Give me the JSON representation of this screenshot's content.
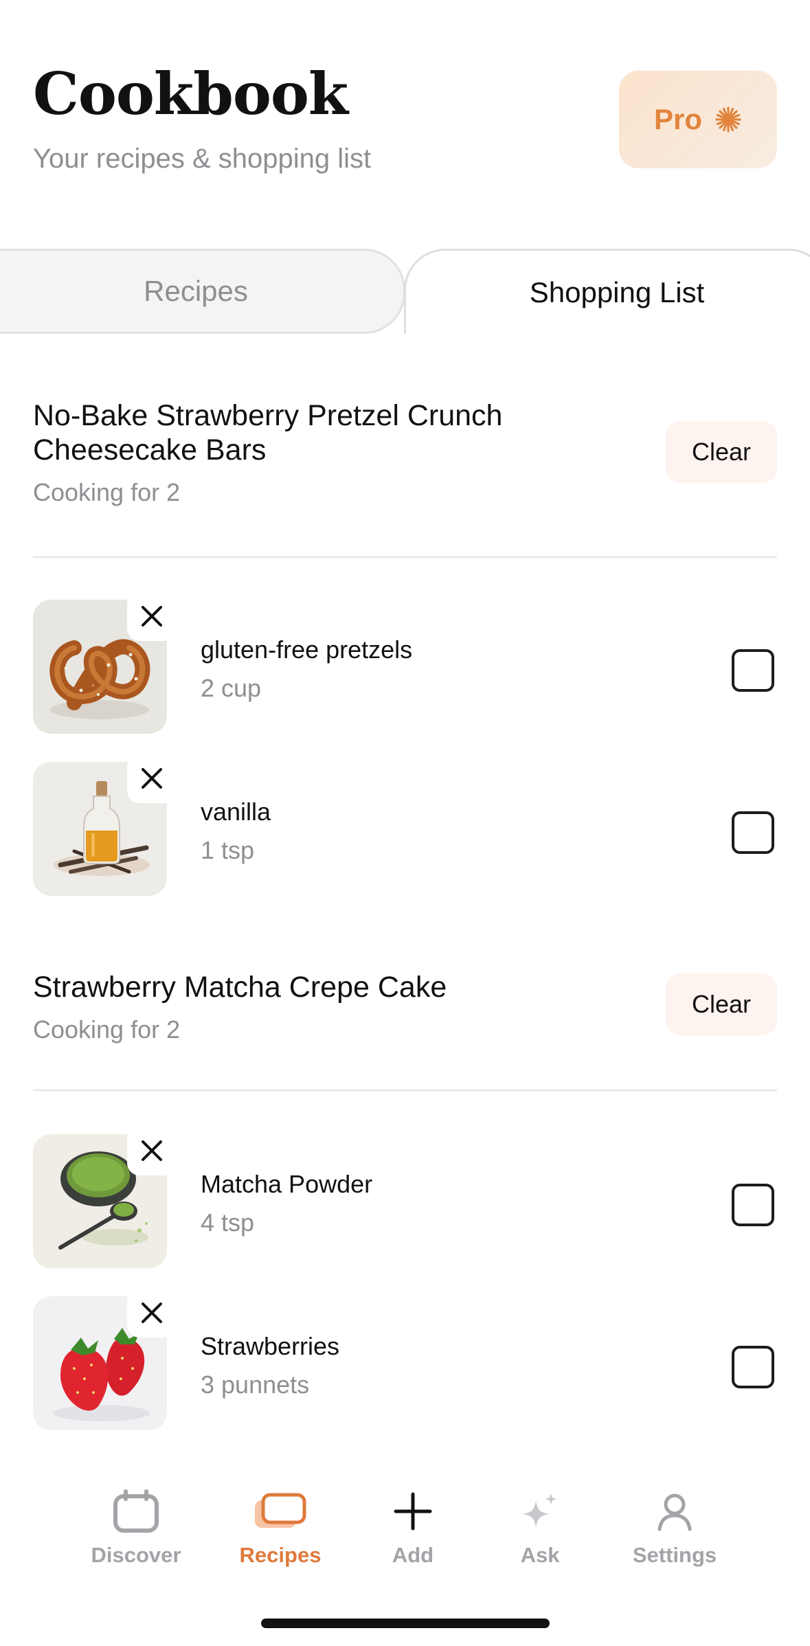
{
  "header": {
    "title": "Cookbook",
    "subtitle": "Your recipes & shopping list",
    "pro_label": "Pro"
  },
  "tabs": [
    {
      "label": "Recipes",
      "active": false
    },
    {
      "label": "Shopping List",
      "active": true
    }
  ],
  "groups": [
    {
      "title": "No-Bake Strawberry Pretzel Crunch Cheesecake Bars",
      "servings": "Cooking for 2",
      "clear_label": "Clear",
      "items": [
        {
          "name": "gluten-free pretzels",
          "quantity": "2 cup",
          "image": "pretzel-image",
          "checked": false
        },
        {
          "name": "vanilla",
          "quantity": "1 tsp",
          "image": "vanilla-bottle-image",
          "checked": false
        }
      ]
    },
    {
      "title": "Strawberry Matcha Crepe Cake",
      "servings": "Cooking for 2",
      "clear_label": "Clear",
      "items": [
        {
          "name": "Matcha Powder",
          "quantity": "4 tsp",
          "image": "matcha-bowl-image",
          "checked": false
        },
        {
          "name": "Strawberries",
          "quantity": "3 punnets",
          "image": "strawberries-image",
          "checked": false
        }
      ]
    }
  ],
  "bottom_nav": [
    {
      "label": "Discover",
      "icon": "calendar-icon",
      "active": false
    },
    {
      "label": "Recipes",
      "icon": "card-stack-icon",
      "active": true
    },
    {
      "label": "Add",
      "icon": "plus-icon",
      "active": false
    },
    {
      "label": "Ask",
      "icon": "sparkle-icon",
      "active": false
    },
    {
      "label": "Settings",
      "icon": "person-icon",
      "active": false
    }
  ],
  "colors": {
    "accent": "#de7a3c",
    "pro_text": "#e2843d",
    "secondary_text": "#8e8e93",
    "clear_bg": "#fdf3ef"
  }
}
